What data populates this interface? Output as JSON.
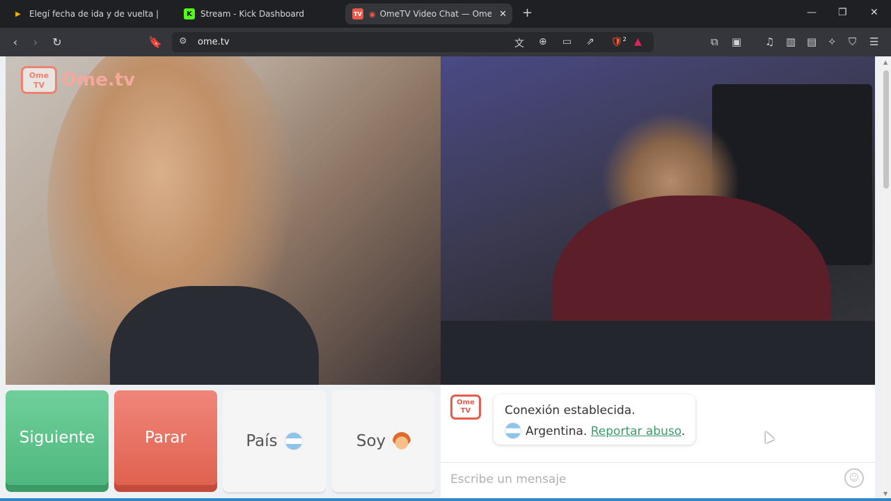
{
  "browser": {
    "tabs": [
      {
        "title": "Elegí fecha de ida y de vuelta | Flybondi",
        "favicon": "flybondi-icon",
        "active": false
      },
      {
        "title": "Stream - Kick Dashboard",
        "favicon": "kick-icon",
        "active": false
      },
      {
        "title": "OmeTV Video Chat — Omegle",
        "favicon": "ometv-icon",
        "active": true
      }
    ],
    "url": "ome.tv",
    "new_tab_symbol": "+",
    "brave_shield_count": "2"
  },
  "logo": {
    "tv_line1": "Ome",
    "tv_line2": "TV",
    "wordmark": "Ome.tv"
  },
  "controls": {
    "next_label": "Siguiente",
    "stop_label": "Parar",
    "country_label": "País",
    "gender_label": "Soy"
  },
  "chat": {
    "logo_line1": "Ome",
    "logo_line2": "TV",
    "status": "Conexión establecida.",
    "country": "Argentina.",
    "report_link": "Reportar abuso",
    "report_suffix": ".",
    "placeholder": "Escribe un mensaje"
  },
  "colors": {
    "next": "#4fb87e",
    "stop": "#e0624f",
    "link": "#3b9a6a",
    "brand": "#e85a4a"
  }
}
